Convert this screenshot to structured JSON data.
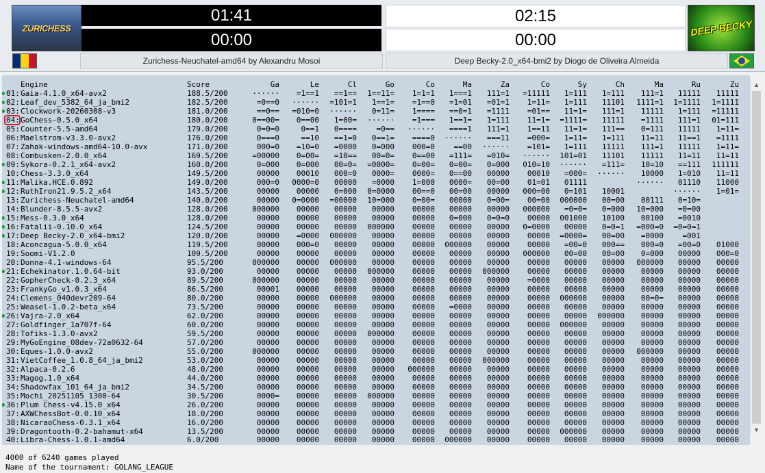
{
  "white": {
    "name": "Zurichess-Neuchatel-amd64 by Alexandru Mosoi",
    "logo": "ZURICHESS",
    "clock_main": "01:41",
    "clock_sub": "00:00",
    "flag": "romania-flag"
  },
  "black": {
    "name": "Deep Becky-2.0_x64-bmi2 by Diogo de Oliveira Almeida",
    "logo": "DEEP BECKY",
    "clock_main": "02:15",
    "clock_sub": "00:00",
    "flag": "brazil-flag"
  },
  "table": {
    "header": [
      "",
      "Engine",
      "Score",
      "Ga",
      "Le",
      "Cl",
      "Go",
      "Co",
      "Ma",
      "Za",
      "Co",
      "Sy",
      "Ch",
      "Ma",
      "Ru",
      "Zu"
    ],
    "rows": [
      {
        "n": "01:",
        "e": "Gaia-4.1.0_x64-avx2",
        "s": "188.5/200",
        "c": [
          "······",
          "=1==1",
          "==1==",
          "1==11=",
          "1=1=1",
          "1===1",
          "111=1",
          "=11111",
          "1=111",
          "1=111",
          "111=1",
          "11111",
          "11111"
        ],
        "dot": true
      },
      {
        "n": "02:",
        "e": "Leaf_dev_5382_64_ja_bmi2",
        "s": "182.5/200",
        "c": [
          "=0==0",
          "······",
          "=101=1",
          "1==1=",
          "=1==0",
          "=1=01",
          "=01=1",
          "1=11=",
          "1=111",
          "11101",
          "1111=1",
          "1=1111",
          "1=1111"
        ],
        "dot": true
      },
      {
        "n": "03:",
        "e": "Clockwork-20260308-v3",
        "s": "181.0/200",
        "c": [
          "==0==",
          "=010=0",
          "······",
          "0=11=",
          "1====",
          "==0=1",
          "=1111",
          "=01==",
          "11=1=",
          "111=1",
          "11111",
          "1=111",
          "=11111"
        ],
        "dot": true
      },
      {
        "n": "04:",
        "e": "GoChess-0.5.0_x64",
        "s": "180.0/200",
        "c": [
          "0==00=",
          "0==00",
          "1=00=",
          "······",
          "=1===",
          "1==1=",
          "1=111",
          "11=1=",
          "=1111=",
          "11111",
          "=1111",
          "111=1",
          "01=111"
        ],
        "dot": false
      },
      {
        "n": "05:",
        "e": "Counter-5.5-amd64",
        "s": "179.0/200",
        "c": [
          "0=0=0",
          "0==1",
          "0====",
          "=0==",
          "······",
          "====1",
          "111=1",
          "1==11",
          "11=1=",
          "111==",
          "0=111",
          "11111",
          "1=11="
        ],
        "dot": false
      },
      {
        "n": "06:",
        "e": "Maelstrom-v3.3.0-avx2",
        "s": "176.0/200",
        "c": [
          "0===0",
          "==10",
          "==1=0",
          "0==1=",
          "====0",
          "······",
          "===11",
          "=000=",
          "1=11=",
          "1=111",
          "11=11",
          "11==1",
          "=1111"
        ],
        "dot": false
      },
      {
        "n": "07:",
        "e": "Zahak-windows-amd64-10.0-avx",
        "s": "171.0/200",
        "c": [
          "000=0",
          "=10=0",
          "=0000",
          "0=000",
          "000=0",
          "==00",
          "······",
          "=101=",
          "1=111",
          "11111",
          "111=1",
          "11111",
          "1=11="
        ],
        "dot": false
      },
      {
        "n": "08:",
        "e": "Combusken-2.0.0_x64",
        "s": "169.5/200",
        "c": [
          "=00000",
          "0=00=",
          "=10==",
          "00=0=",
          "0==00",
          "=111=",
          "=010=",
          "······",
          "101=01",
          "11101",
          "11111",
          "11=11",
          "11=11"
        ],
        "dot": false
      },
      {
        "n": "09:",
        "e": "Sykora-0.2.1_x64-avx2",
        "s": "160.0/200",
        "c": [
          "0=000",
          "0=000",
          "00=0=",
          "=0000=",
          "0=00=",
          "0=00=",
          "0=000",
          "010=10",
          "······",
          "=111=",
          "10=10",
          "==111",
          "111111"
        ],
        "dot": true
      },
      {
        "n": "10:",
        "e": "Chess-3.3.0_x64",
        "s": "149.5/200",
        "c": [
          "00000",
          "00010",
          "000=0",
          "0000=",
          "0000=",
          "0==00",
          "00000",
          "00010",
          "=000=",
          "······",
          "10000",
          "1=010",
          "11=11"
        ],
        "dot": false
      },
      {
        "n": "11:",
        "e": "Malika.HCE.0.892",
        "s": "149.0/200",
        "c": [
          "000=0",
          "0000=0",
          "00000",
          "=0000",
          "1=000",
          "0000=",
          "00=00",
          "01=01",
          "01111",
          "",
          "······",
          "01110",
          "11000"
        ],
        "dot": true
      },
      {
        "n": "12:",
        "e": "RuthIron21.9.5.2_x64",
        "s": "143.5/200",
        "c": [
          "00000",
          "00000",
          "0=000",
          "0=0000",
          "00==0",
          "00=00",
          "00000",
          "000=00",
          "0=101",
          "10001",
          "",
          "······",
          "1=01="
        ],
        "dot": true
      },
      {
        "n": "13:",
        "e": "Zurichess-Neuchatel-amd64",
        "s": "140.0/200",
        "c": [
          "00000",
          "0=0000",
          "=00000",
          "10=000",
          "0=00=",
          "00000",
          "0=00=",
          "00=00",
          "000000",
          "00=00",
          "00111",
          "0=10=",
          ""
        ],
        "dot": false
      },
      {
        "n": "14:",
        "e": "Blunder-8.5.5-avx2",
        "s": "128.0/200",
        "c": [
          "000000",
          "00000",
          "00000",
          "00000",
          "00000",
          "00000",
          "00000",
          "000000",
          "=0=0=",
          "0=000",
          "10=000",
          "=0=00",
          ""
        ],
        "dot": false
      },
      {
        "n": "15:",
        "e": "Mess-0.3.0_x64",
        "s": "128.0/200",
        "c": [
          "00000",
          "00000",
          "00000",
          "00000",
          "00000",
          "0=000",
          "0=0=0",
          "00000",
          "001000",
          "10100",
          "00100",
          "=0010",
          ""
        ],
        "dot": true
      },
      {
        "n": "16:",
        "e": "Fatalii-0.10.0_x64",
        "s": "124.5/200",
        "c": [
          "00000",
          "00000",
          "00000",
          "000000",
          "00000",
          "00000",
          "00000",
          "0=0000",
          "00000",
          "0=0=1",
          "=000=0",
          "=0=0=1",
          ""
        ],
        "dot": true
      },
      {
        "n": "17:",
        "e": "Deep Becky-2.0_x64-bmi2",
        "s": "120.0/200",
        "c": [
          "00000",
          "=0000",
          "000000",
          "00000",
          "00000",
          "00000",
          "00000",
          "00000",
          "=0000=",
          "00=00",
          "=0000",
          "=001",
          ""
        ],
        "dot": true
      },
      {
        "n": "18:",
        "e": "Aconcagua-5.0.0_x64",
        "s": "119.5/200",
        "c": [
          "00000",
          "000=0",
          "00000",
          "00000",
          "00000",
          "000000",
          "00000",
          "00000",
          "=00=0",
          "000==",
          "000=0",
          "=00=0",
          "01000"
        ],
        "dot": false
      },
      {
        "n": "19:",
        "e": "Soomi-V1.2.0",
        "s": "109.5/200",
        "c": [
          "00000",
          "00000",
          "00000",
          "00000",
          "00000",
          "00000",
          "00000",
          "000000",
          "00=00",
          "00=00",
          "0=000",
          "00000",
          "000=0"
        ],
        "dot": false
      },
      {
        "n": "20:",
        "e": "Donna-4.1-windows-64",
        "s": "95.5/200",
        "c": [
          "000000",
          "00000",
          "000000",
          "00000",
          "00000",
          "00000",
          "00000",
          "00000",
          "00000",
          "00000",
          "000000",
          "00000",
          "00000"
        ],
        "dot": false
      },
      {
        "n": "21:",
        "e": "Echekinator.1.0.64-bit",
        "s": "93.0/200",
        "c": [
          "00000",
          "00000",
          "00000",
          "000000",
          "00000",
          "00000",
          "000000",
          "00000",
          "00000",
          "00000",
          "00000",
          "00000",
          "00000"
        ],
        "dot": true
      },
      {
        "n": "22:",
        "e": "GopherCheck-0.2.3_x64",
        "s": "89.5/200",
        "c": [
          "000000",
          "00000",
          "00000",
          "00000",
          "00000",
          "00000",
          "00000",
          "=0000",
          "00000",
          "00000",
          "00000",
          "00000",
          "00000"
        ],
        "dot": false
      },
      {
        "n": "23:",
        "e": "FrankyGo_v1.0.3_x64",
        "s": "86.5/200",
        "c": [
          "00001",
          "00000",
          "00000",
          "00000",
          "00000",
          "00000",
          "00000",
          "00000",
          "00000",
          "00000",
          "00000",
          "00000",
          "00000"
        ],
        "dot": false
      },
      {
        "n": "24:",
        "e": "Clemens_040devr209-64",
        "s": "80.0/200",
        "c": [
          "00000",
          "00000",
          "000000",
          "00000",
          "00000",
          "00000",
          "00000",
          "00000",
          "000000",
          "00000",
          "00=0=",
          "00000",
          "00000"
        ],
        "dot": false
      },
      {
        "n": "25:",
        "e": "Weasel-1.0.2-beta_x64",
        "s": "73.5/200",
        "c": [
          "00000",
          "00000",
          "00000",
          "00000",
          "00000",
          "=0000",
          "00000",
          "00000",
          "00000",
          "00000",
          "00000",
          "00000",
          "00000"
        ],
        "dot": false
      },
      {
        "n": "26:",
        "e": "Vajra-2.0_x64",
        "s": "62.0/200",
        "c": [
          "00000",
          "00000",
          "00000",
          "00000",
          "00000",
          "00000",
          "00000",
          "00000",
          "00000",
          "000000",
          "00000",
          "00000",
          "00000"
        ],
        "dot": true
      },
      {
        "n": "27:",
        "e": "Goldfinger_1a707f-64",
        "s": "60.0/200",
        "c": [
          "00000",
          "00000",
          "00000",
          "00000",
          "00000",
          "00000",
          "00000",
          "00000",
          "000000",
          "00000",
          "00000",
          "00000",
          "00000"
        ],
        "dot": false
      },
      {
        "n": "28:",
        "e": "Tofiks-1.3.0-avx2",
        "s": "59.5/200",
        "c": [
          "00000",
          "00000",
          "00000",
          "000000",
          "00000",
          "00000",
          "00000",
          "00000",
          "00000",
          "00000",
          "00000",
          "00000",
          "00000"
        ],
        "dot": false
      },
      {
        "n": "29:",
        "e": "MyGoEngine_08dev-72a0632-64",
        "s": "57.0/200",
        "c": [
          "00000",
          "00000",
          "00000",
          "00000",
          "00000",
          "00000",
          "00000",
          "00000",
          "00000",
          "00000",
          "00000",
          "00000",
          "00000"
        ],
        "dot": false
      },
      {
        "n": "30:",
        "e": "Eques-1.0.0-avx2",
        "s": "55.0/200",
        "c": [
          "000000",
          "00000",
          "00000",
          "00000",
          "00000",
          "00000",
          "00000",
          "00000",
          "00000",
          "00000",
          "000000",
          "00000",
          "00000"
        ],
        "dot": false
      },
      {
        "n": "31:",
        "e": "VietCoffee_1.0.8_64_ja_bmi2",
        "s": "53.0/200",
        "c": [
          "00000",
          "00000",
          "00000",
          "00000",
          "00000",
          "00000",
          "000000",
          "00000",
          "00000",
          "00000",
          "00000",
          "00000",
          "00000"
        ],
        "dot": false
      },
      {
        "n": "32:",
        "e": "Alpaca-0.2.6",
        "s": "48.0/200",
        "c": [
          "00000",
          "00000",
          "00000",
          "00000",
          "000000",
          "00000",
          "00000",
          "00000",
          "00000",
          "00000",
          "00000",
          "00000",
          "00000"
        ],
        "dot": false
      },
      {
        "n": "33:",
        "e": "Magog.1.0_x64",
        "s": "44.0/200",
        "c": [
          "00000",
          "00000",
          "00000",
          "00000",
          "00000",
          "00000",
          "00000",
          "00000",
          "00000",
          "00000",
          "00000",
          "00000",
          "00000"
        ],
        "dot": false
      },
      {
        "n": "34:",
        "e": "Shadowfax_101_64_ja_bmi2",
        "s": "34.5/200",
        "c": [
          "00000",
          "00000",
          "00000",
          "00000",
          "00000",
          "00000",
          "00000",
          "00000",
          "00000",
          "00000",
          "00000",
          "00000",
          "00000"
        ],
        "dot": false
      },
      {
        "n": "35:",
        "e": "Mochi_20251105_1300-64",
        "s": "30.5/200",
        "c": [
          "0000=",
          "00000",
          "00000",
          "000000",
          "00000",
          "00000",
          "00000",
          "00000",
          "00000",
          "00000",
          "00000",
          "00000",
          "00000"
        ],
        "dot": false
      },
      {
        "n": "36:",
        "e": "Plum Chess-v4.15.0_x64",
        "s": "26.0/200",
        "c": [
          "00000",
          "00000",
          "00000",
          "00000",
          "00000",
          "00000",
          "00000",
          "00000",
          "00000",
          "00000",
          "00000",
          "00000",
          "00000"
        ],
        "dot": true
      },
      {
        "n": "37:",
        "e": "AXWChessBot-0.0.10_x64",
        "s": "18.0/200",
        "c": [
          "00000",
          "00000",
          "00000",
          "00000",
          "00000",
          "00000",
          "00000",
          "00000",
          "00000",
          "00000",
          "00000",
          "00000",
          "00000"
        ],
        "dot": false
      },
      {
        "n": "38:",
        "e": "NicaraoChess-0.3.1_x64",
        "s": "16.0/200",
        "c": [
          "00000",
          "00000",
          "00000",
          "00000",
          "00000",
          "00000",
          "00000",
          "00000",
          "00000",
          "00000",
          "00000",
          "00000",
          "00000"
        ],
        "dot": false
      },
      {
        "n": "39:",
        "e": "Dragontooth-0.2-bahamut-x64",
        "s": "13.5/200",
        "c": [
          "00000",
          "00000",
          "00000",
          "00000",
          "00000",
          "00000",
          "00000",
          "00000",
          "000000",
          "00000",
          "00000",
          "00000",
          "00000"
        ],
        "dot": false
      },
      {
        "n": "40:",
        "e": "Libra-Chess-1.0.1-amd64",
        "s": "6.0/200",
        "c": [
          "00000",
          "00000",
          "00000",
          "00000",
          "00000",
          "000000",
          "00000",
          "00000",
          "00000",
          "00000",
          "00000",
          "00000",
          "00000"
        ],
        "dot": false
      }
    ]
  },
  "status": {
    "games": "4000 of 6240 games played",
    "tournament": "Name of the tournament: GOLANG_LEAGUE"
  },
  "scroll": {
    "up": "▲",
    "down": "▼"
  },
  "colors": {
    "table_bg": "#c9d5e1",
    "dot": "#1f9c3e",
    "highlight": "#c8203a"
  }
}
